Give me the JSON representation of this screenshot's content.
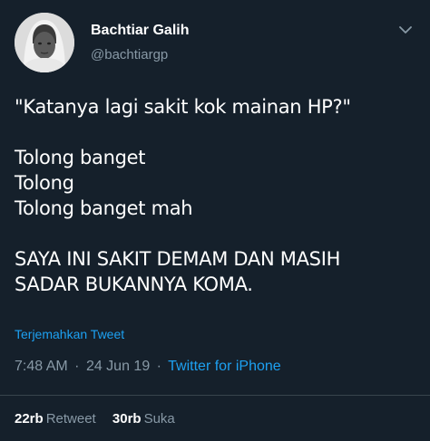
{
  "user": {
    "display_name": "Bachtiar Galih",
    "handle": "@bachtiargp",
    "avatar_icon": "user-photo"
  },
  "tweet": {
    "lines": [
      "\"Katanya lagi sakit kok mainan HP?\"",
      "",
      "Tolong banget",
      "Tolong",
      "Tolong banget mah",
      "",
      "SAYA INI SAKIT DEMAM DAN MASIH",
      "SADAR BUKANNYA KOMA."
    ]
  },
  "translate_label": "Terjemahkan Tweet",
  "meta": {
    "time": "7:48 AM",
    "separator": "·",
    "date": "24 Jun 19",
    "source": "Twitter for iPhone"
  },
  "stats": {
    "retweets_count": "22rb",
    "retweets_label": "Retweet",
    "likes_count": "30rb",
    "likes_label": "Suka"
  },
  "colors": {
    "background": "#15202b",
    "primary_text": "#ffffff",
    "secondary_text": "#8899a6",
    "accent": "#1da1f2",
    "divider": "#38444d"
  },
  "icons": {
    "menu": "chevron-down-icon"
  }
}
